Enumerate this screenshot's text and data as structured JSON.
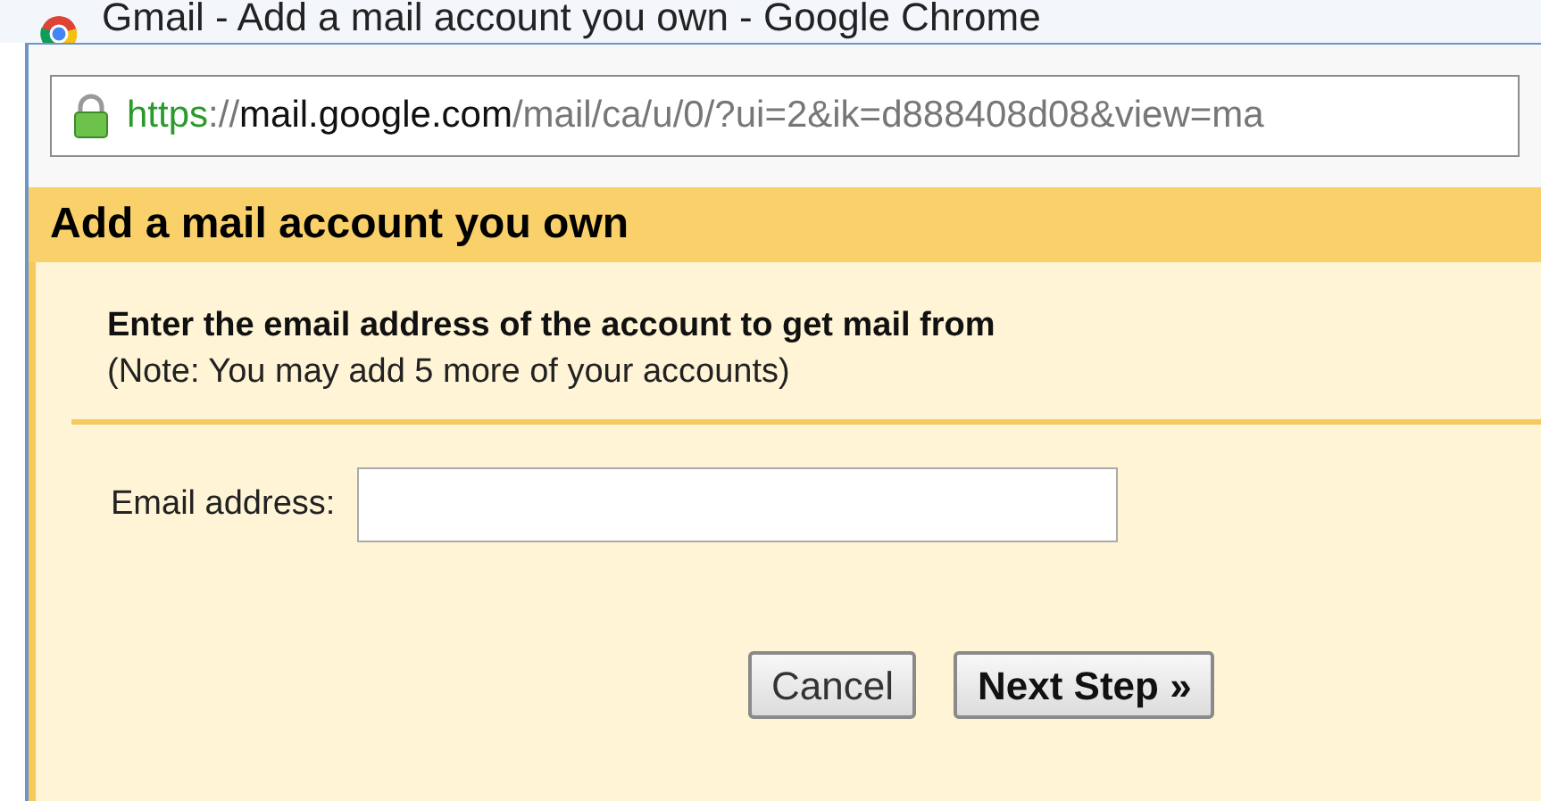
{
  "window": {
    "title": "Gmail - Add a mail account you own - Google Chrome"
  },
  "address_bar": {
    "scheme": "https",
    "separator": "://",
    "host": "mail.google.com",
    "path": "/mail/ca/u/0/?ui=2&ik=d888408d08&view=ma"
  },
  "dialog": {
    "title": "Add a mail account you own",
    "heading": "Enter the email address of the account to get mail from",
    "note": "(Note: You may add 5 more of your accounts)",
    "field": {
      "label": "Email address:"
    },
    "buttons": [
      {
        "label": "Cancel",
        "primary": false
      },
      {
        "label": "Next Step »",
        "primary": true
      }
    ]
  }
}
